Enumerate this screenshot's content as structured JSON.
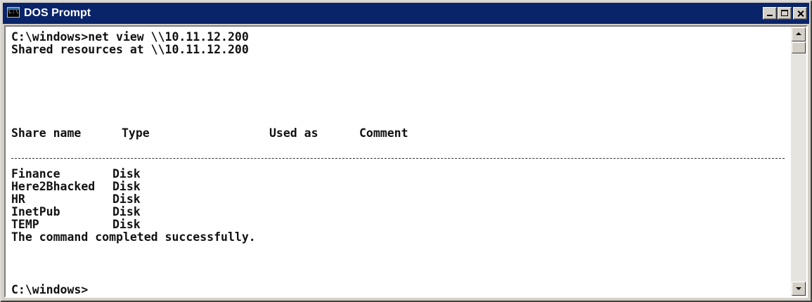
{
  "window": {
    "title": "DOS Prompt",
    "icon": "console-icon"
  },
  "console": {
    "command_line": "C:\\windows>net view \\\\10.11.12.200",
    "shared_at_line": "Shared resources at \\\\10.11.12.200",
    "headers": {
      "share_name": "Share name",
      "type": "Type",
      "used_as": "Used as",
      "comment": "Comment"
    },
    "shares": [
      {
        "name": "Finance",
        "type": "Disk"
      },
      {
        "name": "Here2Bhacked",
        "type": "Disk"
      },
      {
        "name": "HR",
        "type": "Disk"
      },
      {
        "name": "InetPub",
        "type": "Disk"
      },
      {
        "name": "TEMP",
        "type": "Disk"
      }
    ],
    "completion_message": "The command completed successfully.",
    "prompt": "C:\\windows>"
  },
  "colors": {
    "titlebar": "#0a246a",
    "console_background": "#ffffff",
    "console_text": "#111111"
  }
}
